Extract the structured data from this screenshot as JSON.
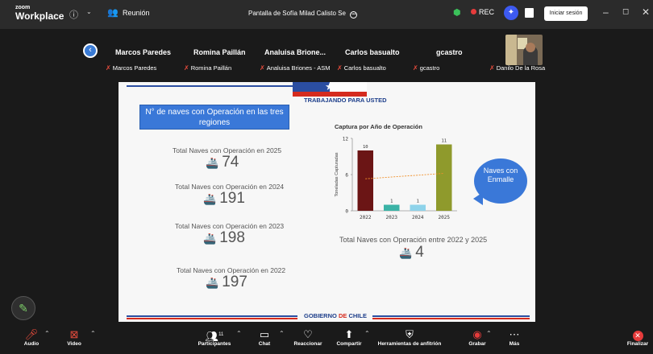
{
  "titlebar": {
    "logo_top": "zoom",
    "logo_bottom": "Workplace",
    "meeting_label": "Reunión",
    "share_label": "Pantalla de Sofía Milad Calisto Se",
    "rec_label": "REC",
    "signin_label": "Iniciar sesión"
  },
  "participants": [
    {
      "name": "Marcos Paredes",
      "sub": "Marcos Paredes"
    },
    {
      "name": "Romina Paillán",
      "sub": "Romina Paillán"
    },
    {
      "name": "Analuisa Brione...",
      "sub": "Analuisa Briones - ASM"
    },
    {
      "name": "Carlos  basualto",
      "sub": "Carlos  basualto"
    },
    {
      "name": "gcastro",
      "sub": "gcastro"
    },
    {
      "name": "",
      "sub": "Danilo De la Rosa"
    }
  ],
  "slide": {
    "header": "TRABAJANDO PARA USTED",
    "box_text": "N° de naves con Operación en las tres regiones",
    "stats": [
      {
        "label": "Total Naves con Operación en 2025",
        "value": "74"
      },
      {
        "label": "Total Naves con Operación en 2024",
        "value": "191"
      },
      {
        "label": "Total Naves con Operación en 2023",
        "value": "198"
      },
      {
        "label": "Total Naves con Operación en 2022",
        "value": "197"
      }
    ],
    "total_label": "Total Naves con Operación entre 2022 y 2025",
    "total_value": "4",
    "callout": "Naves con Enmalle",
    "footer_gob": "GOBIERNO",
    "footer_de": "DE",
    "footer_chile": "CHILE"
  },
  "chart_data": {
    "type": "bar",
    "title": "Captura por Año de Operación",
    "ylabel": "Toneladas Capturadas",
    "xlabel": "",
    "categories": [
      "2022",
      "2023",
      "2024",
      "2025"
    ],
    "values": [
      10,
      1,
      1,
      11
    ],
    "data_labels": [
      "10",
      "1",
      "1",
      "11"
    ],
    "bar_colors": [
      "#6b1515",
      "#3bb3a6",
      "#8ed3ea",
      "#8f9a2c"
    ],
    "yticks": [
      0,
      6,
      12
    ],
    "ylim": [
      0,
      12
    ],
    "trendline": true,
    "trendline_color": "#f0902a"
  },
  "toolbar": {
    "audio": "Audio",
    "video": "Video",
    "participants": "Participantes",
    "participants_count": "11",
    "chat": "Chat",
    "react": "Reaccionar",
    "share": "Compartir",
    "host_tools": "Herramientas de anfitrión",
    "record": "Grabar",
    "more": "Más",
    "end": "Finalizar"
  },
  "colors": {
    "accent_blue": "#3a78d8",
    "rec_red": "#e63b3b",
    "muted_red": "#e84c3d",
    "chile_blue": "#2b4ea1",
    "chile_red": "#d52b1e"
  }
}
